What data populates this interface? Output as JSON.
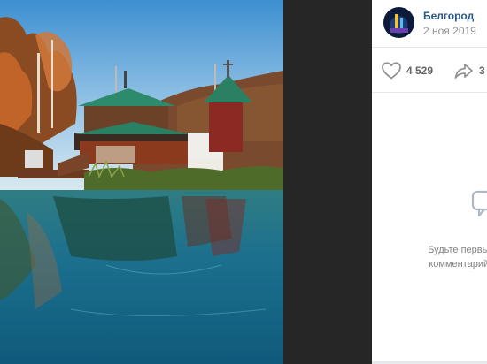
{
  "post": {
    "author_name": "Белгород",
    "date": "2 ноя 2019"
  },
  "actions": {
    "likes_count": "4 529",
    "shares_count": "3"
  },
  "comments": {
    "empty_line1": "Будьте первым, кто оставит",
    "empty_line2": "комментарий к этой записи"
  },
  "colors": {
    "link": "#2a5885",
    "muted": "#939393",
    "background_dark": "#262626"
  },
  "icons": [
    "heart-icon",
    "share-icon",
    "comment-bubble-icon"
  ]
}
